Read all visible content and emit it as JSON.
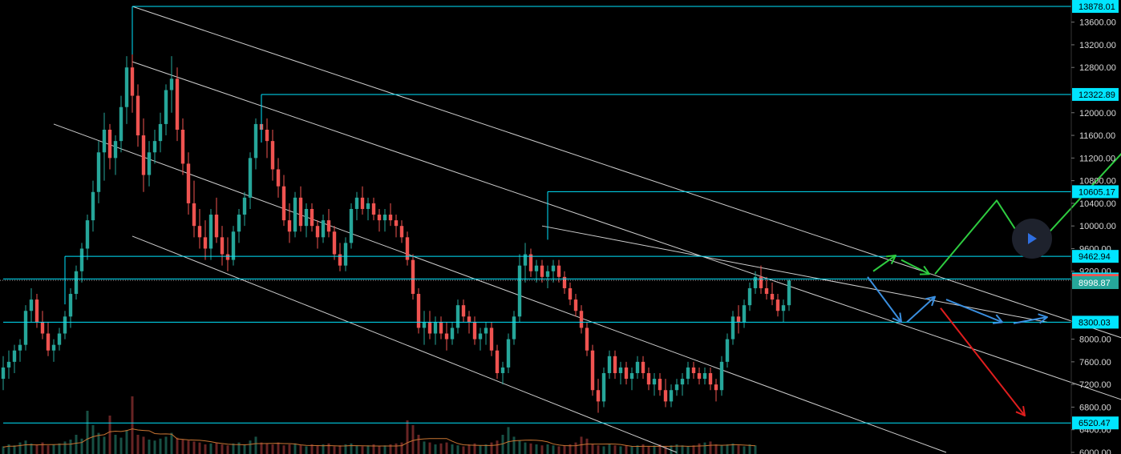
{
  "chart_data": {
    "type": "candlestick",
    "ylim": [
      6000,
      13878.01
    ],
    "y_ticks": [
      "13600.00",
      "13200.00",
      "12800.00",
      "12000.00",
      "11600.00",
      "11200.00",
      "10800.00",
      "10400.00",
      "10000.00",
      "9600.00",
      "9200.00",
      "8000.00",
      "7600.00",
      "7200.00",
      "6800.00",
      "6400.00",
      "6000.00"
    ],
    "y_tick_values": [
      13600,
      13200,
      12800,
      12000,
      11600,
      11200,
      10800,
      10400,
      10000,
      9600,
      9200,
      8000,
      7600,
      7200,
      6800,
      6400,
      6000
    ],
    "levels": [
      {
        "label": "13878.01",
        "value": 13878.01,
        "start_index": 23,
        "color": "#00e5ff",
        "text_color": "#000000"
      },
      {
        "label": "12322.89",
        "value": 12322.89,
        "start_index": 46,
        "color": "#00e5ff",
        "text_color": "#000000"
      },
      {
        "label": "10605.17",
        "value": 10605.17,
        "start_index": 97,
        "color": "#00e5ff",
        "text_color": "#000000"
      },
      {
        "label": "9462.94",
        "value": 9462.94,
        "start_index": 11,
        "color": "#00e5ff",
        "text_color": "#000000"
      },
      {
        "label": "9063.02",
        "value": 9063.02,
        "start_index": 0,
        "color": "#00e5ff",
        "text_color": "#000000"
      },
      {
        "label": "8300.03",
        "value": 8300.03,
        "start_index": 0,
        "color": "#00e5ff",
        "text_color": "#000000"
      },
      {
        "label": "6520.47",
        "value": 6520.47,
        "start_index": 0,
        "color": "#00e5ff",
        "text_color": "#000000"
      }
    ],
    "price_tags": [
      {
        "label": "9039.74",
        "value": 9039.74,
        "color": "#ef5350"
      },
      {
        "label": "8998.87",
        "value": 8998.87,
        "color": "#26a69a"
      }
    ],
    "channel_lines": [
      {
        "from": [
          23,
          13878.01
        ],
        "to": [
          212,
          7600
        ]
      },
      {
        "from": [
          23,
          12900
        ],
        "to": [
          212,
          6500
        ]
      },
      {
        "from": [
          9,
          11800
        ],
        "to": [
          168,
          6000
        ]
      },
      {
        "from": [
          23,
          9820
        ],
        "to": [
          120,
          6000
        ]
      },
      {
        "from": [
          96,
          10000
        ],
        "to": [
          186,
          8300
        ]
      }
    ],
    "arrows": [
      {
        "color": "#2ecc40",
        "points": [
          [
            155,
            9200
          ],
          [
            159,
            9480
          ]
        ]
      },
      {
        "color": "#2ecc40",
        "points": [
          [
            160,
            9400
          ],
          [
            165,
            9150
          ]
        ]
      },
      {
        "color": "#2ecc40",
        "points": [
          [
            166,
            9150
          ],
          [
            177,
            10450
          ],
          [
            183,
            9530
          ],
          [
            205,
            11900
          ]
        ]
      },
      {
        "color": "#3a8fe0",
        "points": [
          [
            154,
            9100
          ],
          [
            160,
            8300
          ]
        ]
      },
      {
        "color": "#3a8fe0",
        "points": [
          [
            161,
            8300
          ],
          [
            166,
            8750
          ]
        ]
      },
      {
        "color": "#3a8fe0",
        "points": [
          [
            168,
            8700
          ],
          [
            178,
            8300
          ]
        ]
      },
      {
        "color": "#3a8fe0",
        "points": [
          [
            180,
            8280
          ],
          [
            186,
            8390
          ]
        ]
      },
      {
        "color": "#e01e1e",
        "points": [
          [
            167,
            8550
          ],
          [
            182,
            6650
          ]
        ]
      }
    ],
    "candles": [
      [
        7300,
        7700,
        7100,
        7500
      ],
      [
        7500,
        7800,
        7300,
        7600
      ],
      [
        7600,
        7900,
        7400,
        7800
      ],
      [
        7800,
        8000,
        7600,
        7900
      ],
      [
        7900,
        8600,
        7800,
        8500
      ],
      [
        8500,
        8900,
        8300,
        8700
      ],
      [
        8700,
        8800,
        8200,
        8300
      ],
      [
        8300,
        8500,
        8000,
        8100
      ],
      [
        8100,
        8300,
        7700,
        7800
      ],
      [
        7800,
        8000,
        7600,
        7900
      ],
      [
        7900,
        8200,
        7800,
        8100
      ],
      [
        8100,
        8500,
        8000,
        8400
      ],
      [
        8400,
        8900,
        8200,
        8800
      ],
      [
        8800,
        9300,
        8700,
        9200
      ],
      [
        9200,
        9700,
        9000,
        9600
      ],
      [
        9600,
        10200,
        9400,
        10100
      ],
      [
        10100,
        10800,
        9900,
        10600
      ],
      [
        10600,
        11500,
        10400,
        11300
      ],
      [
        11300,
        12000,
        10800,
        11700
      ],
      [
        11700,
        11800,
        11000,
        11200
      ],
      [
        11200,
        11600,
        10900,
        11500
      ],
      [
        11500,
        12300,
        11300,
        12100
      ],
      [
        12100,
        13000,
        11800,
        12800
      ],
      [
        12800,
        13878,
        12000,
        12300
      ],
      [
        12300,
        12500,
        11400,
        11600
      ],
      [
        11600,
        11900,
        10600,
        10900
      ],
      [
        10900,
        11500,
        10700,
        11300
      ],
      [
        11300,
        11700,
        11100,
        11500
      ],
      [
        11500,
        12000,
        11300,
        11800
      ],
      [
        11800,
        12500,
        11600,
        12400
      ],
      [
        12400,
        13000,
        12000,
        12600
      ],
      [
        12600,
        12800,
        11500,
        11700
      ],
      [
        11700,
        11900,
        10900,
        11100
      ],
      [
        11100,
        11300,
        10200,
        10400
      ],
      [
        10400,
        10800,
        9800,
        10000
      ],
      [
        10000,
        10300,
        9600,
        9800
      ],
      [
        9800,
        10100,
        9400,
        9600
      ],
      [
        9600,
        10300,
        9400,
        10200
      ],
      [
        10200,
        10500,
        9700,
        9800
      ],
      [
        9800,
        10000,
        9300,
        9500
      ],
      [
        9500,
        9800,
        9200,
        9400
      ],
      [
        9400,
        10000,
        9300,
        9900
      ],
      [
        9900,
        10300,
        9700,
        10200
      ],
      [
        10200,
        10600,
        10000,
        10500
      ],
      [
        10500,
        11300,
        10300,
        11200
      ],
      [
        11200,
        11900,
        11000,
        11800
      ],
      [
        11800,
        12322,
        11500,
        11700
      ],
      [
        11700,
        11900,
        11200,
        11500
      ],
      [
        11500,
        11700,
        10800,
        11000
      ],
      [
        11000,
        11200,
        10500,
        10700
      ],
      [
        10700,
        10900,
        10000,
        10100
      ],
      [
        10100,
        10400,
        9700,
        9900
      ],
      [
        9900,
        10600,
        9800,
        10500
      ],
      [
        10500,
        10700,
        9900,
        10000
      ],
      [
        10000,
        10400,
        9800,
        10300
      ],
      [
        10300,
        10400,
        9900,
        10000
      ],
      [
        10000,
        10100,
        9600,
        9800
      ],
      [
        9800,
        10200,
        9700,
        10100
      ],
      [
        10100,
        10300,
        9800,
        9900
      ],
      [
        9900,
        10000,
        9400,
        9500
      ],
      [
        9500,
        9700,
        9200,
        9300
      ],
      [
        9300,
        9800,
        9200,
        9700
      ],
      [
        9700,
        10400,
        9600,
        10300
      ],
      [
        10300,
        10600,
        10100,
        10500
      ],
      [
        10500,
        10700,
        10200,
        10300
      ],
      [
        10300,
        10500,
        10100,
        10400
      ],
      [
        10400,
        10500,
        10100,
        10200
      ],
      [
        10200,
        10300,
        9900,
        10100
      ],
      [
        10100,
        10300,
        9900,
        10200
      ],
      [
        10200,
        10400,
        10000,
        10100
      ],
      [
        10100,
        10200,
        9800,
        10000
      ],
      [
        10000,
        10100,
        9700,
        9800
      ],
      [
        9800,
        9900,
        9300,
        9400
      ],
      [
        9400,
        9500,
        8700,
        8800
      ],
      [
        8800,
        8900,
        8100,
        8200
      ],
      [
        8200,
        8500,
        7900,
        8300
      ],
      [
        8300,
        8500,
        8000,
        8100
      ],
      [
        8100,
        8400,
        7900,
        8300
      ],
      [
        8300,
        8400,
        8000,
        8100
      ],
      [
        8100,
        8300,
        7800,
        8000
      ],
      [
        8000,
        8300,
        7900,
        8200
      ],
      [
        8200,
        8700,
        8100,
        8600
      ],
      [
        8600,
        8700,
        8300,
        8400
      ],
      [
        8400,
        8500,
        8100,
        8300
      ],
      [
        8300,
        8400,
        7900,
        8000
      ],
      [
        8000,
        8200,
        7800,
        8100
      ],
      [
        8100,
        8300,
        7900,
        8200
      ],
      [
        8200,
        8300,
        7700,
        7800
      ],
      [
        7800,
        7900,
        7300,
        7400
      ],
      [
        7400,
        7600,
        7200,
        7500
      ],
      [
        7500,
        8100,
        7400,
        8000
      ],
      [
        8000,
        8500,
        7900,
        8400
      ],
      [
        8400,
        9500,
        8300,
        9300
      ],
      [
        9300,
        9700,
        9000,
        9500
      ],
      [
        9500,
        9600,
        9100,
        9200
      ],
      [
        9200,
        9400,
        9000,
        9300
      ],
      [
        9300,
        9400,
        9000,
        9100
      ],
      [
        9100,
        9300,
        8900,
        9200
      ],
      [
        9200,
        9400,
        9000,
        9300
      ],
      [
        9300,
        9400,
        9000,
        9100
      ],
      [
        9100,
        9200,
        8800,
        8900
      ],
      [
        8900,
        9000,
        8600,
        8700
      ],
      [
        8700,
        8800,
        8400,
        8500
      ],
      [
        8500,
        8600,
        8100,
        8200
      ],
      [
        8200,
        8300,
        7700,
        7800
      ],
      [
        7800,
        7900,
        7000,
        7100
      ],
      [
        7100,
        7300,
        6700,
        6900
      ],
      [
        6900,
        7500,
        6800,
        7400
      ],
      [
        7400,
        7800,
        7300,
        7700
      ],
      [
        7700,
        7800,
        7300,
        7400
      ],
      [
        7400,
        7600,
        7200,
        7500
      ],
      [
        7500,
        7600,
        7200,
        7300
      ],
      [
        7300,
        7500,
        7100,
        7400
      ],
      [
        7400,
        7700,
        7300,
        7600
      ],
      [
        7600,
        7700,
        7300,
        7400
      ],
      [
        7400,
        7500,
        7100,
        7200
      ],
      [
        7200,
        7400,
        7000,
        7300
      ],
      [
        7300,
        7400,
        7000,
        7100
      ],
      [
        7100,
        7300,
        6800,
        6900
      ],
      [
        6900,
        7200,
        6800,
        7100
      ],
      [
        7100,
        7300,
        7000,
        7200
      ],
      [
        7200,
        7400,
        7000,
        7300
      ],
      [
        7300,
        7600,
        7200,
        7500
      ],
      [
        7500,
        7600,
        7300,
        7400
      ],
      [
        7400,
        7500,
        7200,
        7300
      ],
      [
        7300,
        7500,
        7200,
        7400
      ],
      [
        7400,
        7500,
        7100,
        7200
      ],
      [
        7200,
        7300,
        6900,
        7100
      ],
      [
        7100,
        7700,
        7000,
        7600
      ],
      [
        7600,
        8100,
        7500,
        8000
      ],
      [
        8000,
        8500,
        7900,
        8400
      ],
      [
        8400,
        8600,
        8100,
        8300
      ],
      [
        8300,
        8700,
        8200,
        8600
      ],
      [
        8600,
        9000,
        8500,
        8900
      ],
      [
        8900,
        9200,
        8800,
        9100
      ],
      [
        9100,
        9300,
        8800,
        8900
      ],
      [
        8900,
        9100,
        8700,
        8800
      ],
      [
        8800,
        9000,
        8600,
        8700
      ],
      [
        8700,
        8800,
        8400,
        8500
      ],
      [
        8500,
        8700,
        8300,
        8600
      ],
      [
        8600,
        9050,
        8500,
        9039.74
      ]
    ],
    "volumes": [
      0.08,
      0.1,
      0.09,
      0.12,
      0.14,
      0.11,
      0.1,
      0.12,
      0.09,
      0.1,
      0.11,
      0.13,
      0.15,
      0.2,
      0.16,
      0.45,
      0.3,
      0.22,
      0.18,
      0.4,
      0.2,
      0.17,
      0.25,
      0.6,
      0.2,
      0.18,
      0.15,
      0.14,
      0.16,
      0.18,
      0.22,
      0.17,
      0.15,
      0.14,
      0.13,
      0.12,
      0.1,
      0.11,
      0.12,
      0.1,
      0.09,
      0.11,
      0.12,
      0.1,
      0.14,
      0.18,
      0.12,
      0.11,
      0.1,
      0.12,
      0.09,
      0.1,
      0.11,
      0.09,
      0.08,
      0.1,
      0.09,
      0.1,
      0.11,
      0.08,
      0.09,
      0.1,
      0.11,
      0.09,
      0.08,
      0.09,
      0.1,
      0.08,
      0.09,
      0.1,
      0.11,
      0.12,
      0.35,
      0.3,
      0.2,
      0.13,
      0.12,
      0.1,
      0.11,
      0.12,
      0.1,
      0.09,
      0.08,
      0.1,
      0.11,
      0.09,
      0.1,
      0.12,
      0.14,
      0.2,
      0.28,
      0.18,
      0.14,
      0.12,
      0.11,
      0.1,
      0.09,
      0.1,
      0.09,
      0.08,
      0.09,
      0.1,
      0.12,
      0.18,
      0.16,
      0.1,
      0.09,
      0.08,
      0.1,
      0.09,
      0.08,
      0.09,
      0.08,
      0.09,
      0.1,
      0.08,
      0.09,
      0.1,
      0.08,
      0.09,
      0.1,
      0.09,
      0.08,
      0.09,
      0.11,
      0.12,
      0.13,
      0.1,
      0.09,
      0.1,
      0.11,
      0.09,
      0.08,
      0.1,
      0.09
    ]
  },
  "icons": {
    "play": "play-icon"
  }
}
